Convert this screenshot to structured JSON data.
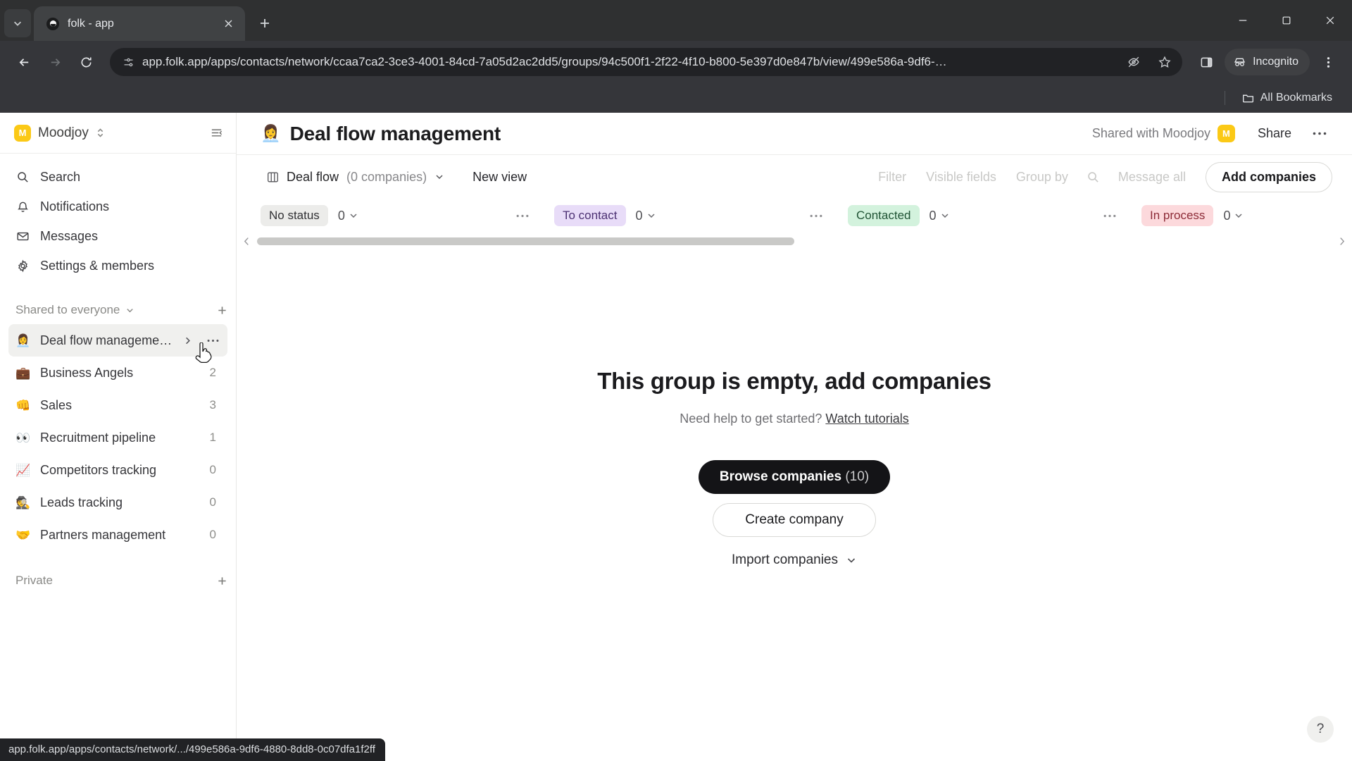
{
  "browser": {
    "tab": {
      "title": "folk - app",
      "favicon": "folk-icon"
    },
    "new_tab_label": "+",
    "url": "app.folk.app/apps/contacts/network/ccaa7ca2-3ce3-4001-84cd-7a05d2ac2dd5/groups/94c500f1-2f22-4f10-b800-5e397d0e847b/view/499e586a-9df6-…",
    "incognito_label": "Incognito",
    "bookmarks_label": "All Bookmarks",
    "status_bar": "app.folk.app/apps/contacts/network/.../499e586a-9df6-4880-8dd8-0c07dfa1f2ff"
  },
  "sidebar": {
    "workspace": {
      "name": "Moodjoy",
      "initial": "M",
      "logo_color": "#fbc916"
    },
    "nav": [
      {
        "label": "Search",
        "icon": "search-icon"
      },
      {
        "label": "Notifications",
        "icon": "bell-icon"
      },
      {
        "label": "Messages",
        "icon": "envelope-icon"
      },
      {
        "label": "Settings & members",
        "icon": "gear-icon"
      }
    ],
    "shared_section": {
      "label": "Shared to everyone",
      "add_label": "+"
    },
    "groups": [
      {
        "emoji": "👩‍💼",
        "label": "Deal flow manageme…",
        "count": "",
        "active": true
      },
      {
        "emoji": "💼",
        "label": "Business Angels",
        "count": "2",
        "active": false
      },
      {
        "emoji": "👊",
        "label": "Sales",
        "count": "3",
        "active": false
      },
      {
        "emoji": "👀",
        "label": "Recruitment pipeline",
        "count": "1",
        "active": false
      },
      {
        "emoji": "📈",
        "label": "Competitors tracking",
        "count": "0",
        "active": false
      },
      {
        "emoji": "🕵️",
        "label": "Leads tracking",
        "count": "0",
        "active": false
      },
      {
        "emoji": "🤝",
        "label": "Partners management",
        "count": "0",
        "active": false
      }
    ],
    "private_section": {
      "label": "Private",
      "add_label": "+"
    }
  },
  "main": {
    "header": {
      "emoji": "👩‍💼",
      "title": "Deal flow management",
      "shared_with": "Shared with Moodjoy",
      "avatar_initial": "M",
      "share_label": "Share"
    },
    "viewbar": {
      "view_name": "Deal flow",
      "view_count": "(0 companies)",
      "new_view_label": "New view",
      "filter_label": "Filter",
      "visible_fields_label": "Visible fields",
      "group_by_label": "Group by",
      "message_all_label": "Message all",
      "add_companies_label": "Add companies"
    },
    "kanban": {
      "columns": [
        {
          "status": "No status",
          "count": "0",
          "style": "nostatus",
          "color": "#ececea"
        },
        {
          "status": "To contact",
          "count": "0",
          "style": "tocontact",
          "color": "#e8dcf8"
        },
        {
          "status": "Contacted",
          "count": "0",
          "style": "contacted",
          "color": "#d3f2dd"
        },
        {
          "status": "In process",
          "count": "0",
          "style": "inprocess",
          "color": "#fcd9dc"
        }
      ]
    },
    "empty_state": {
      "title": "This group is empty, add companies",
      "help_text": "Need help to get started?",
      "help_link": "Watch tutorials",
      "browse_label": "Browse companies",
      "browse_count": "(10)",
      "create_label": "Create company",
      "import_label": "Import companies"
    },
    "help_fab": "?"
  }
}
